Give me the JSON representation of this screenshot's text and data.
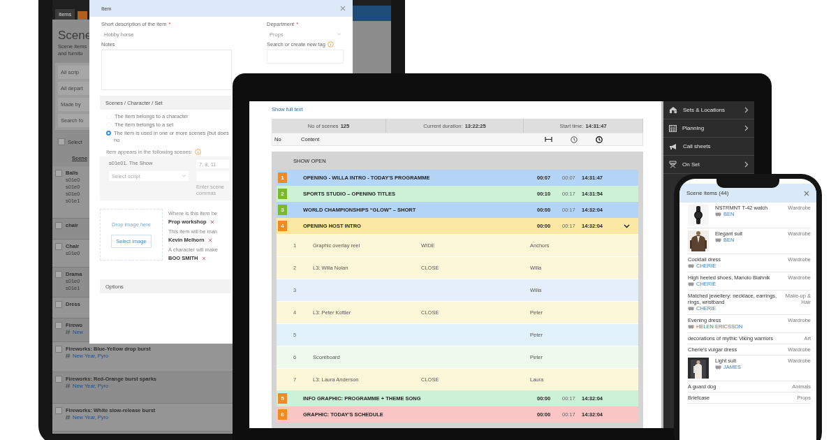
{
  "tablet": {
    "tab": "Items",
    "heading": "Scene",
    "intro": [
      "Scene items",
      "and furnitu"
    ],
    "filters": [
      "All scrip",
      "All depart",
      "Made by",
      "Search fo"
    ],
    "select_all": {
      "label": "Select",
      "checked": false
    },
    "column": "Scene",
    "items": [
      {
        "name": "Balls",
        "checked": false,
        "scenes": [
          "s01e0",
          "s01e0",
          "s01e0",
          "s01e1"
        ]
      },
      {
        "name": "chair",
        "checked": false
      },
      {
        "name": "Chair",
        "checked": false,
        "scenes": [
          "s01e0"
        ]
      },
      {
        "name": "Drama",
        "checked": false,
        "scenes": [
          "s01e0",
          "s01e1"
        ]
      },
      {
        "name": "Dress",
        "checked": false
      },
      {
        "name": "Firewo",
        "checked": false,
        "tags": "New"
      },
      {
        "name": "Fireworks: Blue-Yellow drop burst",
        "checked": false,
        "tags": "New Year, Pyro"
      },
      {
        "name": "Fireworks: Red-Orange burst sparks",
        "checked": false,
        "tags": "New Year, Pyro"
      },
      {
        "name": "Fireworks: White slow-release burst",
        "checked": false,
        "tags": "New Year, Pyro"
      }
    ]
  },
  "modal": {
    "title": "Item",
    "description": {
      "label": "Short description of the item",
      "required_mark": "*",
      "value": "Hobby horse"
    },
    "department": {
      "label": "Department",
      "required_mark": "*",
      "value": "Props"
    },
    "notes_label": "Notes",
    "tag_label": "Search or create new tag",
    "section": "Scenes / Character / Set",
    "options": [
      {
        "label": "The item belongs to a character",
        "selected": false
      },
      {
        "label": "The item belongs to a set",
        "selected": false
      },
      {
        "label": "The item is used in one or more scenes (but does no",
        "selected": true
      }
    ],
    "appears_label": "Item appears in the following scenes:",
    "scene": "s01e01. The Show",
    "scene_numbers": "7, 8, 11",
    "script_placeholder": "Select script",
    "scene_hint": [
      "Enter scene",
      "commas"
    ],
    "drop_text": "Drop image here",
    "select_image": "Select image",
    "assignments": [
      {
        "label": "Where is this item be",
        "value": "Prop workshop"
      },
      {
        "label": "This item will be man",
        "value": "Kevin Melhorn"
      },
      {
        "label": "A character will make",
        "value": "BOO SMITH"
      }
    ],
    "options_section": "Options"
  },
  "rundown": {
    "link": "Show full text",
    "summary": [
      {
        "label": "No of scenes",
        "value": "125"
      },
      {
        "label": "Current duration:",
        "value": "13:22:25"
      },
      {
        "label": "Start time:",
        "value": "14:31:47"
      }
    ],
    "columns": [
      "No",
      "Content"
    ],
    "group": "SHOW OPEN",
    "scenes": [
      {
        "badge": {
          "number": "1",
          "color": "#f08a24"
        },
        "color": "#b5d5f7",
        "title": "OPENING - WILLA INTRO - TODAY'S PROGRAMME",
        "duration": "00:07",
        "total": "00:07",
        "start": "14:31:47",
        "expanded": false
      },
      {
        "badge": {
          "number": "2",
          "color": "#7cb82f"
        },
        "color": "#cdf1d6",
        "title": "SPORTS STUDIO – OPENING TITLES",
        "duration": "00:10",
        "total": "00:17",
        "start": "14:31:54",
        "expanded": false
      },
      {
        "badge": {
          "number": "3",
          "color": "#7cb82f"
        },
        "color": "#b5d5f7",
        "title": "WORLD CHAMPIONSHIPS “GLOW” – SHORT",
        "duration": "00:00",
        "total": "00:17",
        "start": "14:32:04",
        "expanded": false
      },
      {
        "badge": {
          "number": "4",
          "color": "#f08a24"
        },
        "color": "#fbe9a3",
        "title": "OPENING HOST INTRO",
        "duration": "00:00",
        "total": "00:17",
        "start": "14:32:04",
        "expanded": true,
        "shots": [
          {
            "number": "1",
            "content": "Graphic overlay reel",
            "shot": "WIDE",
            "person": "Anchors",
            "color": "#fdf7d9"
          },
          {
            "number": "2",
            "content": "L3: Willa Nolan",
            "shot": "CLOSE",
            "person": "Willa",
            "color": "#fdf7d9"
          },
          {
            "number": "3",
            "person": "Willa",
            "color": "#e4effb"
          },
          {
            "number": "4",
            "content": "L3: Peter Kottler",
            "shot": "CLOSE",
            "person": "Peter",
            "color": "#fdf7d9"
          },
          {
            "number": "5",
            "person": "Peter",
            "color": "#e2f2fb"
          },
          {
            "number": "6",
            "content": "Scoreboard",
            "person": "Peter",
            "color": "#eff9ee"
          },
          {
            "number": "7",
            "content": "L3: Laura Anderson",
            "shot": "CLOSE",
            "person": "Laura",
            "color": "#fdf7d9"
          }
        ]
      },
      {
        "badge": {
          "number": "5",
          "color": "#f08a24"
        },
        "color": "#cdf1d6",
        "title": "INFO GRAPHIC: PROGRAMME + THEME SONG",
        "duration": "00:00",
        "total": "00:17",
        "start": "14:32:04",
        "expanded": false
      },
      {
        "badge": {
          "number": "6",
          "color": "#f08a24"
        },
        "color": "#f9c5c5",
        "title": "GRAPHIC: TODAY'S SCHEDULE",
        "duration": "00:00",
        "total": "00:17",
        "start": "14:32:04",
        "expanded": false
      }
    ]
  },
  "sidebar": [
    {
      "label": "Sets & Locations",
      "submenu": true
    },
    {
      "label": "Planning",
      "submenu": true
    },
    {
      "label": "Call sheets",
      "submenu": false
    },
    {
      "label": "On Set",
      "submenu": true
    }
  ],
  "phone": {
    "title": "Scene items (44)",
    "items": [
      {
        "name": "NSTRMNT T-42 watch",
        "character": "BEN",
        "department": "Wardrobe"
      },
      {
        "name": "Elegant suit",
        "character": "BEN",
        "department": "Wardrobe"
      },
      {
        "name": "Cocktail dress",
        "character": "CHERIE",
        "department": "Wardrobe"
      },
      {
        "name": "High heeled shoes, Manolo Blahnik",
        "character": "CHERIE",
        "department": "Wardrobe"
      },
      {
        "name": "Matched jewellery: necklace, earrings, rings, wristband",
        "character": "CHERIE",
        "department": "Make-up & Hair"
      },
      {
        "name": "Evening dress",
        "character": "HELEN ERICSSON",
        "department": "Wardrobe"
      },
      {
        "name": "decorations of mythic Viking warriors",
        "department": "Art"
      },
      {
        "name": "Cherie's vulgar dress",
        "department": "Wardrobe"
      },
      {
        "name": "Light suit",
        "character": "JAMES",
        "department": "Wardrobe"
      },
      {
        "name": "A guard dog",
        "department": "Animals"
      },
      {
        "name": "Briefcase",
        "department": "Props"
      }
    ]
  }
}
